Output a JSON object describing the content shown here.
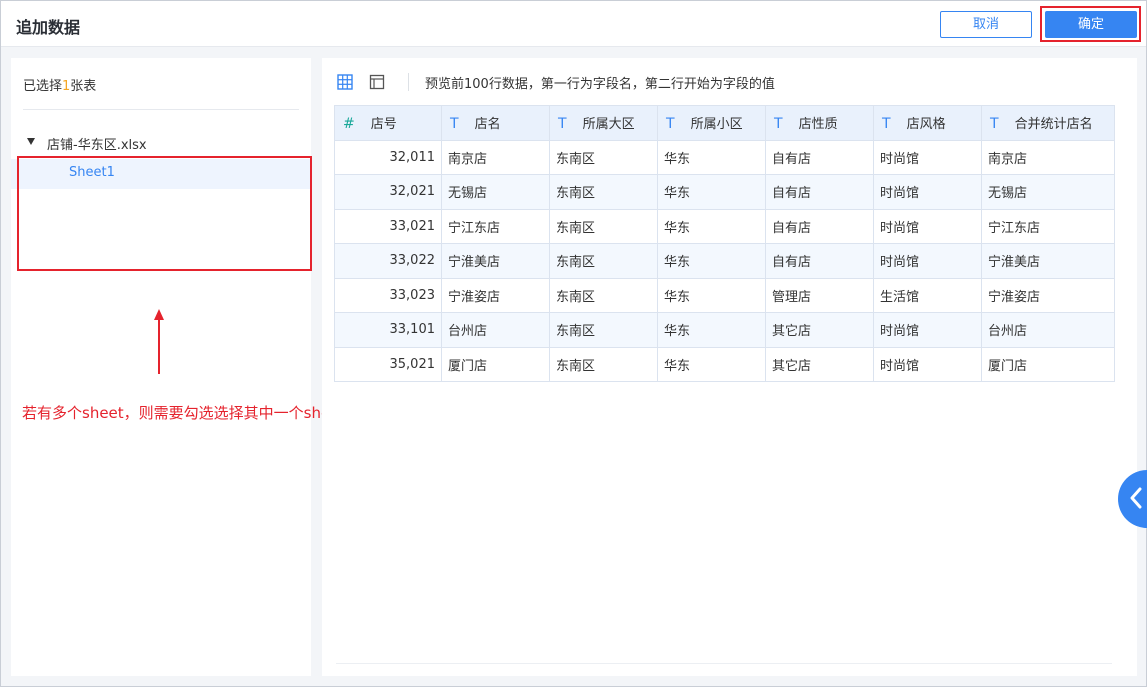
{
  "header": {
    "title": "追加数据",
    "cancel_label": "取消",
    "confirm_label": "确定"
  },
  "left": {
    "selected_prefix": "已选择",
    "selected_count": "1",
    "selected_suffix": "张表",
    "file_name": "店铺-华东区.xlsx",
    "sheet_name": "Sheet1"
  },
  "annotation": {
    "text": "若有多个sheet，则需要勾选选择其中一个sheet"
  },
  "toolbar": {
    "tip": "预览前100行数据，第一行为字段名，第二行开始为字段的值"
  },
  "table": {
    "columns": [
      {
        "type_icon": "#",
        "label": "店号"
      },
      {
        "type_icon": "T",
        "label": "店名"
      },
      {
        "type_icon": "T",
        "label": "所属大区"
      },
      {
        "type_icon": "T",
        "label": "所属小区"
      },
      {
        "type_icon": "T",
        "label": "店性质"
      },
      {
        "type_icon": "T",
        "label": "店风格"
      },
      {
        "type_icon": "T",
        "label": "合并统计店名"
      }
    ],
    "rows": [
      [
        "32,011",
        "南京店",
        "东南区",
        "华东",
        "自有店",
        "时尚馆",
        "南京店"
      ],
      [
        "32,021",
        "无锡店",
        "东南区",
        "华东",
        "自有店",
        "时尚馆",
        "无锡店"
      ],
      [
        "33,021",
        "宁江东店",
        "东南区",
        "华东",
        "自有店",
        "时尚馆",
        "宁江东店"
      ],
      [
        "33,022",
        "宁淮美店",
        "东南区",
        "华东",
        "自有店",
        "时尚馆",
        "宁淮美店"
      ],
      [
        "33,023",
        "宁淮姿店",
        "东南区",
        "华东",
        "管理店",
        "生活馆",
        "宁淮姿店"
      ],
      [
        "33,101",
        "台州店",
        "东南区",
        "华东",
        "其它店",
        "时尚馆",
        "台州店"
      ],
      [
        "35,021",
        "厦门店",
        "东南区",
        "华东",
        "其它店",
        "时尚馆",
        "厦门店"
      ]
    ]
  },
  "colors": {
    "accent": "#3685f2",
    "highlight_red": "#e5232d",
    "count_orange": "#f5a623"
  }
}
